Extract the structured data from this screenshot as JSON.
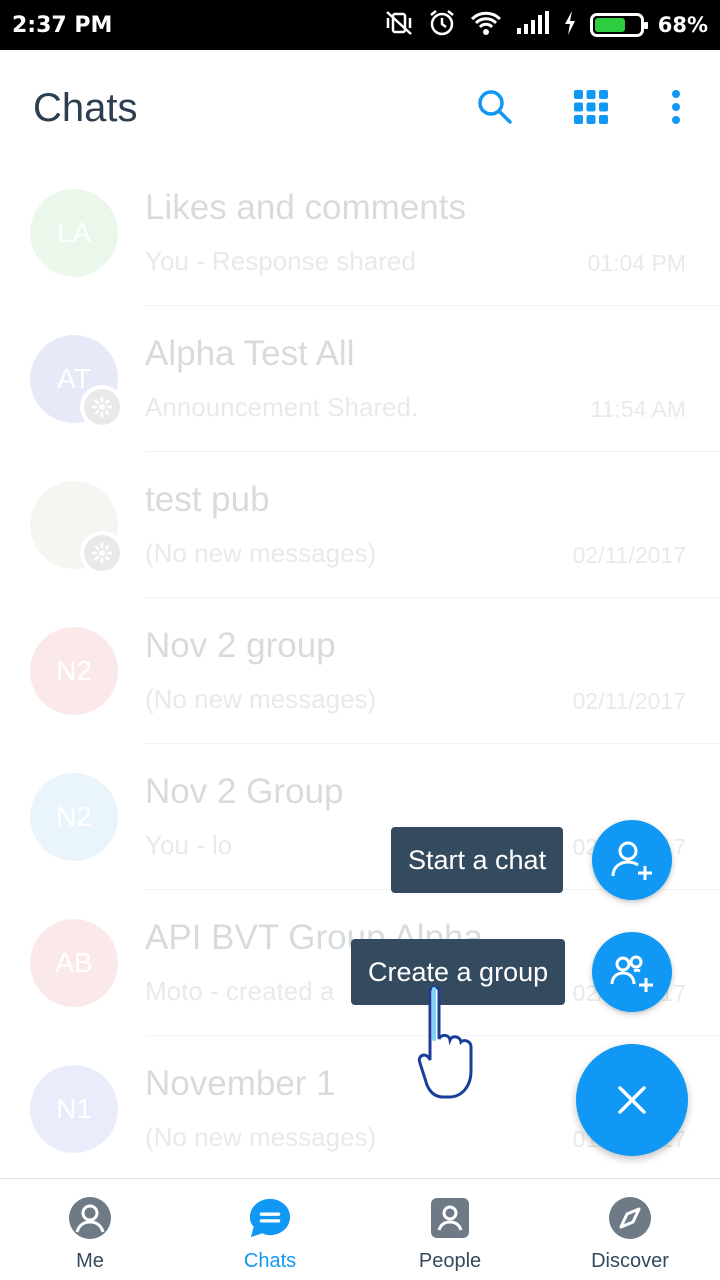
{
  "status_bar": {
    "time": "2:37 PM",
    "battery": "68%",
    "battery_level": 0.68
  },
  "header": {
    "title": "Chats"
  },
  "chats": [
    {
      "initials": "LA",
      "name": "Likes and comments",
      "message": "You - Response shared",
      "time": "01:04 PM",
      "avatar_color": "#9ad89a"
    },
    {
      "initials": "AT",
      "name": "Alpha Test All",
      "message": "Announcement Shared.",
      "time": "11:54 AM",
      "avatar_color": "#7b8cde",
      "badge": true
    },
    {
      "initials": "",
      "name": "test pub",
      "message": "(No new messages)",
      "time": "02/11/2017",
      "avatar_color": "#c9c9b8",
      "badge": true
    },
    {
      "initials": "N2",
      "name": "Nov 2 group",
      "message": "(No new messages)",
      "time": "02/11/2017",
      "avatar_color": "#ee8a8a"
    },
    {
      "initials": "N2",
      "name": "Nov 2 Group",
      "message": "You - lo",
      "time": "02/11/2017",
      "avatar_color": "#8ccbea"
    },
    {
      "initials": "AB",
      "name": "API BVT Group Alpha",
      "message": "Moto - created a",
      "time": "02/11/2017",
      "avatar_color": "#ee8a8a"
    },
    {
      "initials": "N1",
      "name": "November 1",
      "message": "(No new messages)",
      "time": "01/11/2017",
      "avatar_color": "#8a9ae8"
    }
  ],
  "fab_menu": {
    "start_chat_label": "Start a chat",
    "create_group_label": "Create a group"
  },
  "bottom_nav": [
    {
      "label": "Me"
    },
    {
      "label": "Chats"
    },
    {
      "label": "People"
    },
    {
      "label": "Discover"
    }
  ],
  "colors": {
    "accent": "#1197f4",
    "tooltip_bg": "#344a5e"
  }
}
